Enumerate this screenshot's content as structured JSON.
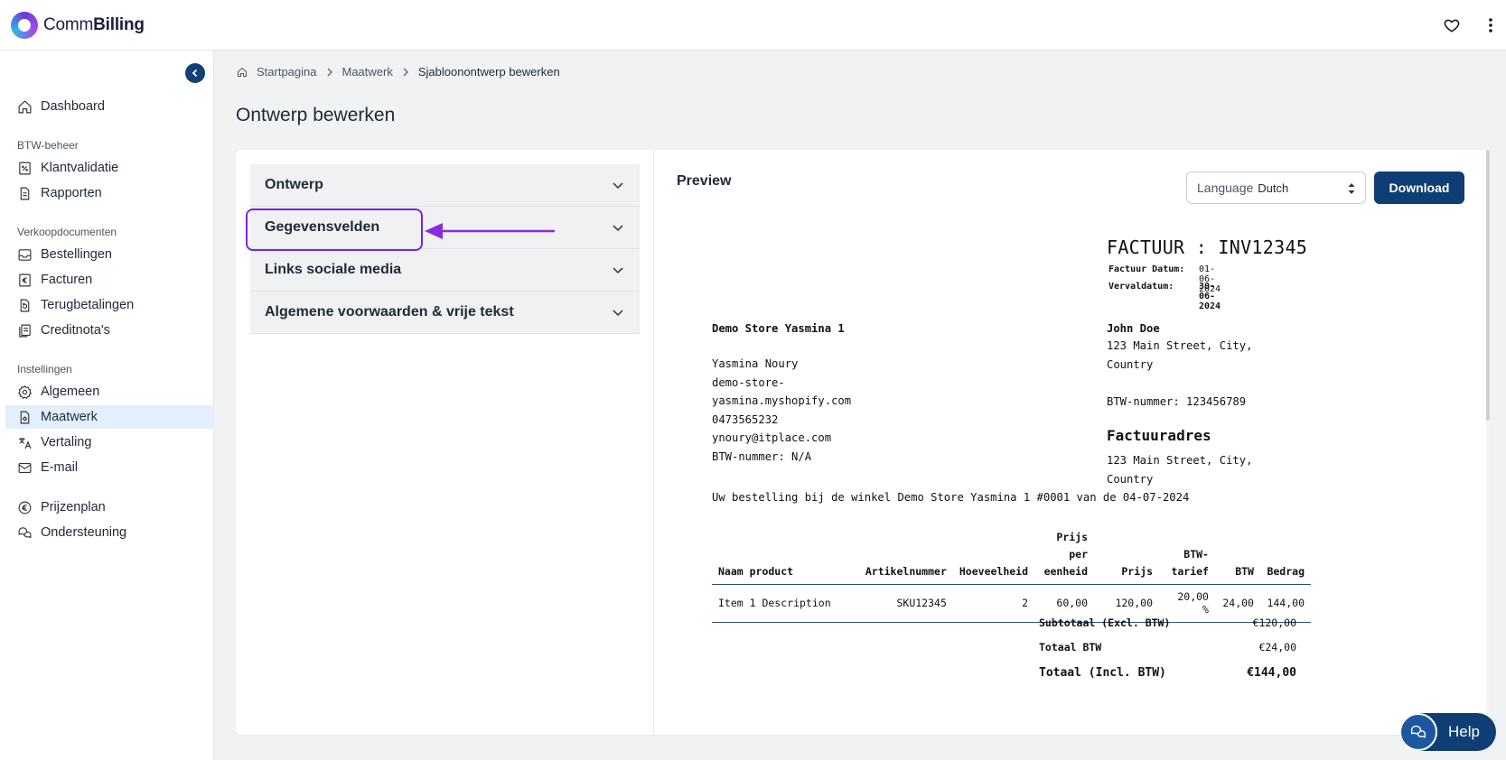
{
  "app": {
    "logo_prefix": "Comm",
    "logo_suffix": "Billing"
  },
  "sidebar": {
    "items_top": [
      {
        "label": "Dashboard",
        "icon": "home-icon"
      }
    ],
    "section_btw": "BTW-beheer",
    "items_btw": [
      {
        "label": "Klantvalidatie",
        "icon": "percent-doc-icon"
      },
      {
        "label": "Rapporten",
        "icon": "document-icon"
      }
    ],
    "section_verkoop": "Verkoopdocumenten",
    "items_verkoop": [
      {
        "label": "Bestellingen",
        "icon": "inbox-icon"
      },
      {
        "label": "Facturen",
        "icon": "euro-doc-icon"
      },
      {
        "label": "Terugbetalingen",
        "icon": "refund-doc-icon"
      },
      {
        "label": "Creditnota's",
        "icon": "stacked-docs-icon"
      }
    ],
    "section_instellingen": "Instellingen",
    "items_instellingen": [
      {
        "label": "Algemeen",
        "icon": "gear-icon"
      },
      {
        "label": "Maatwerk",
        "icon": "custom-doc-icon",
        "active": true
      },
      {
        "label": "Vertaling",
        "icon": "translate-icon"
      },
      {
        "label": "E-mail",
        "icon": "mail-icon"
      }
    ],
    "items_bottom": [
      {
        "label": "Prijzenplan",
        "icon": "euro-circle-icon"
      },
      {
        "label": "Ondersteuning",
        "icon": "chat-icon"
      }
    ]
  },
  "breadcrumb": {
    "home": "Startpagina",
    "parent": "Maatwerk",
    "current": "Sjabloonontwerp bewerken"
  },
  "page_title": "Ontwerp bewerken",
  "accordion": [
    "Ontwerp",
    "Gegevensvelden",
    "Links sociale media",
    "Algemene voorwaarden & vrije tekst"
  ],
  "preview": {
    "title": "Preview",
    "language_label": "Language",
    "language_value": "Dutch",
    "download_label": "Download"
  },
  "invoice": {
    "header": "FACTUUR : INV12345",
    "date_label": "Factuur Datum:",
    "date_value": "01-06-2024",
    "due_label": "Vervaldatum:",
    "due_value": "30-06-2024",
    "store_name": "Demo Store Yasmina 1",
    "seller_lines": "Yasmina Noury\ndemo-store-\nyasmina.myshopify.com\n0473565232\nynoury@itplace.com\nBTW-nummer: N/A",
    "customer_name": "John Doe",
    "customer_lines": "123 Main Street, City,\nCountry\n\nBTW-nummer: 123456789",
    "billing_title": "Factuuradres",
    "billing_lines": "123 Main Street, City,\nCountry",
    "order_line": "Uw bestelling bij de winkel Demo Store Yasmina 1 #0001 van de 04-07-2024",
    "columns": {
      "product": "Naam product",
      "sku": "Artikelnummer",
      "qty": "Hoeveelheid",
      "unit_price": "Prijs per eenheid",
      "price": "Prijs",
      "vat_rate": "BTW-tarief",
      "vat": "BTW",
      "amount": "Bedrag"
    },
    "rows": [
      {
        "product": "Item 1 Description",
        "sku": "SKU12345",
        "qty": "2",
        "unit_price": "60,00",
        "price": "120,00",
        "vat_rate": "20,00 %",
        "vat": "24,00",
        "amount": "144,00"
      }
    ],
    "subtotal_label": "Subtotaal (Excl. BTW)",
    "subtotal_value": "€120,00",
    "vat_total_label": "Totaal BTW",
    "vat_total_value": "€24,00",
    "total_label": "Totaal (Incl. BTW)",
    "total_value": "€144,00"
  },
  "help_label": "Help",
  "colors": {
    "primary": "#0f3e74",
    "highlight": "#7c22e6",
    "active_nav": "#e3efff"
  }
}
